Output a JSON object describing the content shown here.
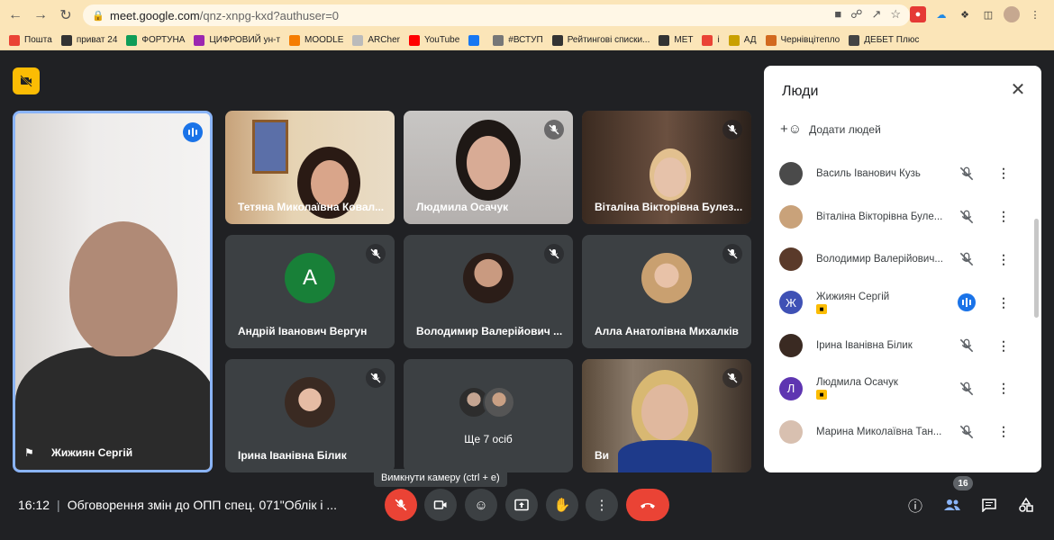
{
  "browser": {
    "url_host": "meet.google.com",
    "url_path": "/qnz-xnpg-kxd?authuser=0",
    "bookmarks": [
      {
        "label": "Пошта",
        "color": "#ea4335"
      },
      {
        "label": "приват 24",
        "color": "#333333"
      },
      {
        "label": "ФОРТУНА",
        "color": "#0f9d58"
      },
      {
        "label": "ЦИФРОВИЙ ун-т",
        "color": "#9c27b0"
      },
      {
        "label": "MOODLE",
        "color": "#f57c00"
      },
      {
        "label": "ARCher",
        "color": "#bbbbbb"
      },
      {
        "label": "YouTube",
        "color": "#ff0000"
      },
      {
        "label": "",
        "color": "#1877f2"
      },
      {
        "label": "#ВСТУП",
        "color": "#777777"
      },
      {
        "label": "Рейтингові списки...",
        "color": "#333333"
      },
      {
        "label": "MET",
        "color": "#333333"
      },
      {
        "label": "і",
        "color": "#ea4335"
      },
      {
        "label": "АД",
        "color": "#c9a000"
      },
      {
        "label": "Чернівцітепло",
        "color": "#d2691e"
      },
      {
        "label": "ДЕБЕТ Плюс",
        "color": "#444444"
      }
    ]
  },
  "meet": {
    "speaker": {
      "name": "Жижиян Сергій"
    },
    "tiles": [
      {
        "name": "Тетяна Миколаївна Ковал...",
        "muted": false
      },
      {
        "name": "Людмила Осачук",
        "muted": true
      },
      {
        "name": "Віталіна Вікторівна Булез...",
        "muted": true
      },
      {
        "name": "Андрій Іванович Вергун",
        "muted": true,
        "initial": "A",
        "color": "#188038"
      },
      {
        "name": "Володимир Валерійович ...",
        "muted": true
      },
      {
        "name": "Алла Анатолівна Михалків",
        "muted": true
      },
      {
        "name": "Ірина Іванівна Білик",
        "muted": true
      },
      {
        "name": "Ще 7 осіб",
        "muted": false
      },
      {
        "name": "Ви",
        "muted": true
      }
    ],
    "bottom": {
      "time": "16:12",
      "meeting_title": "Обговорення змін до ОПП спец. 071\"Облік і ...",
      "tooltip": "Вимкнути камеру (ctrl + e)",
      "participants_count": "16"
    },
    "people_panel": {
      "title": "Люди",
      "add_people": "Додати людей",
      "participants": [
        {
          "name": "Василь Іванович Кузь",
          "muted": true,
          "host": false,
          "color": "#4a4a4a"
        },
        {
          "name": "Віталіна Вікторівна Буле...",
          "muted": true,
          "host": false,
          "color": "#c9a27a"
        },
        {
          "name": "Володимир Валерійович...",
          "muted": true,
          "host": false,
          "color": "#5a3a2a"
        },
        {
          "name": "Жижиян Сергій",
          "muted": false,
          "host": true,
          "initial": "Ж",
          "color": "#3f51b5"
        },
        {
          "name": "Ірина Іванівна Білик",
          "muted": true,
          "host": false,
          "color": "#3a2a22"
        },
        {
          "name": "Людмила Осачук",
          "muted": true,
          "host": true,
          "initial": "Л",
          "color": "#5e35b1"
        },
        {
          "name": "Марина Миколаївна Тан...",
          "muted": true,
          "host": false,
          "color": "#d8c0b0"
        }
      ]
    }
  }
}
